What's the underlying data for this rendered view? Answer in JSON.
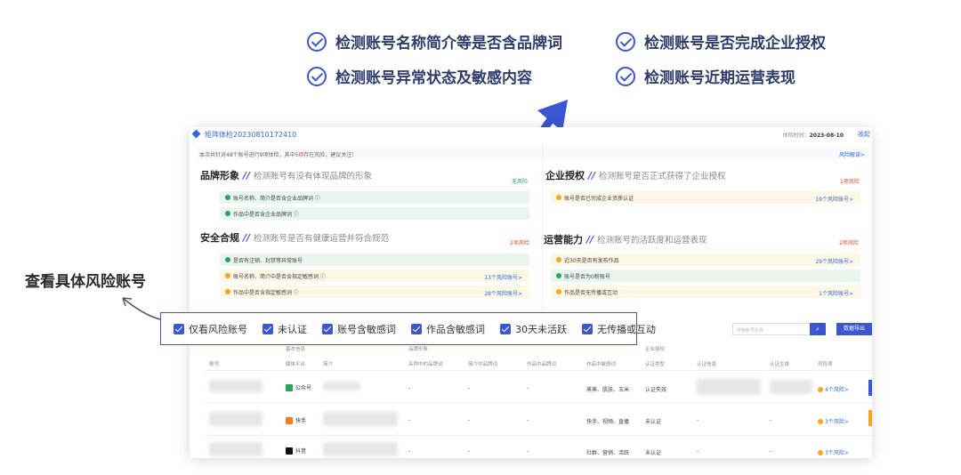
{
  "features": [
    "检测账号名称简介等是否含品牌词",
    "检测账号是否完成企业授权",
    "检测账号异常状态及敏感内容",
    "检测账号近期运营表现"
  ],
  "callout": "查看具体风险账号",
  "report": {
    "title": "矩阵体检20230810172410",
    "check_time_label": "体检时间：",
    "check_time_value": "2023-08-10",
    "collapse": "收起",
    "summary_prefix": "本次共针对48个账号进行9项体检，其中",
    "summary_highlight": "5项",
    "summary_suffix": "存在风险，建议关注！",
    "risk_explain": "风险解读>"
  },
  "sections": {
    "brand": {
      "title": "品牌形象",
      "desc": "检测账号有没有体现品牌的形象",
      "tag": "无风险",
      "rows": [
        {
          "text": "账号名称、简介是否含企业品牌词 ⓘ",
          "count": ""
        },
        {
          "text": "作品中是否含企业品牌词 ⓘ",
          "count": ""
        }
      ]
    },
    "auth": {
      "title": "企业授权",
      "desc": "检测账号是否正式获得了企业授权",
      "tag": "1项风险",
      "rows": [
        {
          "text": "账号是否已完成企业资质认证",
          "count": "19个风险账号>"
        }
      ]
    },
    "safety": {
      "title": "安全合规",
      "desc": "检测账号是否有健康运营并符合规范",
      "tag": "2项风险",
      "rows": [
        {
          "text": "是否有注销、封禁等异常账号",
          "count": ""
        },
        {
          "text": "账号名称、简介中是否含指定敏感词 ⓘ",
          "count": "13个风险账号>"
        },
        {
          "text": "作品中是否含指定敏感词 ⓘ",
          "count": "28个风险账号>"
        }
      ]
    },
    "ops": {
      "title": "运营能力",
      "desc": "检测账号的活跃度和运营表现",
      "tag": "2项风险",
      "rows": [
        {
          "text": "近30天是否有发布作品",
          "count": "29个风险账号>"
        },
        {
          "text": "账号是否为0粉账号",
          "count": ""
        },
        {
          "text": "作品是否无传播或互动",
          "count": "1个风险账号>"
        }
      ]
    }
  },
  "filters": [
    "仅看风险账号",
    "未认证",
    "账号含敏感词",
    "作品含敏感词",
    "30天未活跃",
    "无传播或互动"
  ],
  "search": {
    "placeholder": "搜索账号名称",
    "export": "数据导出"
  },
  "table": {
    "groups": [
      "基本信息",
      "品牌形象",
      "企业授权"
    ],
    "headers": [
      "账号",
      "媒体平台",
      "简介",
      "名称中的品牌词",
      "简介中品牌词",
      "作品中品牌词",
      "作品中敏感词",
      "认证类型",
      "认证信息",
      "认证主体",
      "风险项"
    ],
    "rows": [
      {
        "platform": "公众号",
        "platform_color": "#2aa55a",
        "c1": "-",
        "c2": "-",
        "c3": "-",
        "sensitive": "蒸蒸、肌肤、玉米",
        "auth": "认证失效",
        "info": "",
        "subject": "",
        "risk": "4个风险>"
      },
      {
        "platform": "快手",
        "platform_color": "#ff7a1a",
        "c1": "-",
        "c2": "-",
        "c3": "-",
        "sensitive": "快手、视频、直播",
        "auth": "未认证",
        "info": "-",
        "subject": "-",
        "risk": "3个风险>"
      },
      {
        "platform": "抖音",
        "platform_color": "#111111",
        "c1": "-",
        "c2": "-",
        "c3": "-",
        "sensitive": "社群、营销、活跃",
        "auth": "未认证",
        "info": "-",
        "subject": "-",
        "risk": "3个风险>"
      }
    ]
  }
}
